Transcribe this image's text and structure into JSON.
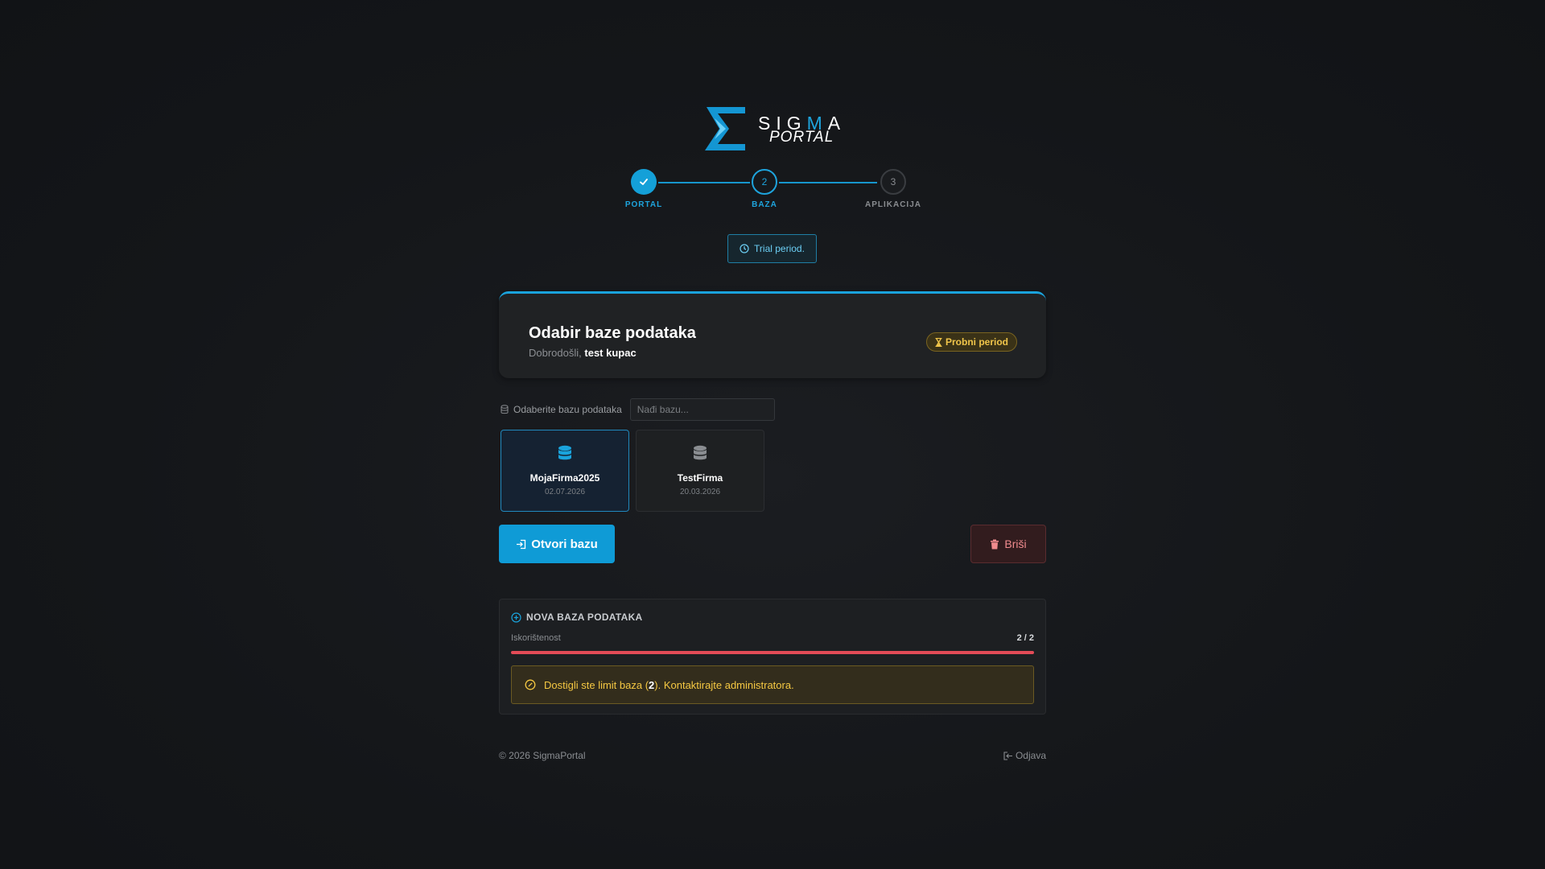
{
  "brand": {
    "word_pre": "SIG",
    "word_acc": "M",
    "word_post": "A",
    "sub": "PORTAL",
    "accent_color": "#1ea4dd"
  },
  "stepper": {
    "steps": [
      {
        "label": "PORTAL",
        "state": "done",
        "icon": "check-icon"
      },
      {
        "label": "BAZA",
        "number": "2",
        "state": "active"
      },
      {
        "label": "APLIKACIJA",
        "number": "3",
        "state": "pending"
      }
    ]
  },
  "trial_chip": {
    "text": "Trial period.",
    "icon": "clock-icon"
  },
  "card": {
    "title": "Odabir baze podataka",
    "welcome_prefix": "Dobrodošli,",
    "user_name": "test kupac",
    "badge": "Probni period",
    "badge_icon": "hourglass-icon"
  },
  "select": {
    "label": "Odaberite bazu podataka",
    "search_placeholder": "Nađi bazu...",
    "search_value": ""
  },
  "databases": [
    {
      "name": "MojaFirma2025",
      "date": "02.07.2026",
      "selected": true
    },
    {
      "name": "TestFirma",
      "date": "20.03.2026",
      "selected": false
    }
  ],
  "actions": {
    "open_label": "Otvori bazu",
    "delete_label": "Briši"
  },
  "new_db": {
    "title": "NOVA BAZA PODATAKA",
    "usage_label": "Iskorištenost",
    "usage_value": "2 / 2",
    "usage_fraction": 1.0,
    "alert_prefix": "Dostigli ste limit baza (",
    "alert_limit": "2",
    "alert_suffix": "). Kontaktirajte administratora."
  },
  "footer": {
    "copyright": "© 2026 SigmaPortal",
    "logout": "Odjava"
  },
  "colors": {
    "primary": "#0f9bd6",
    "danger": "#e34b57",
    "warning": "#f5c842",
    "background": "#141619"
  }
}
